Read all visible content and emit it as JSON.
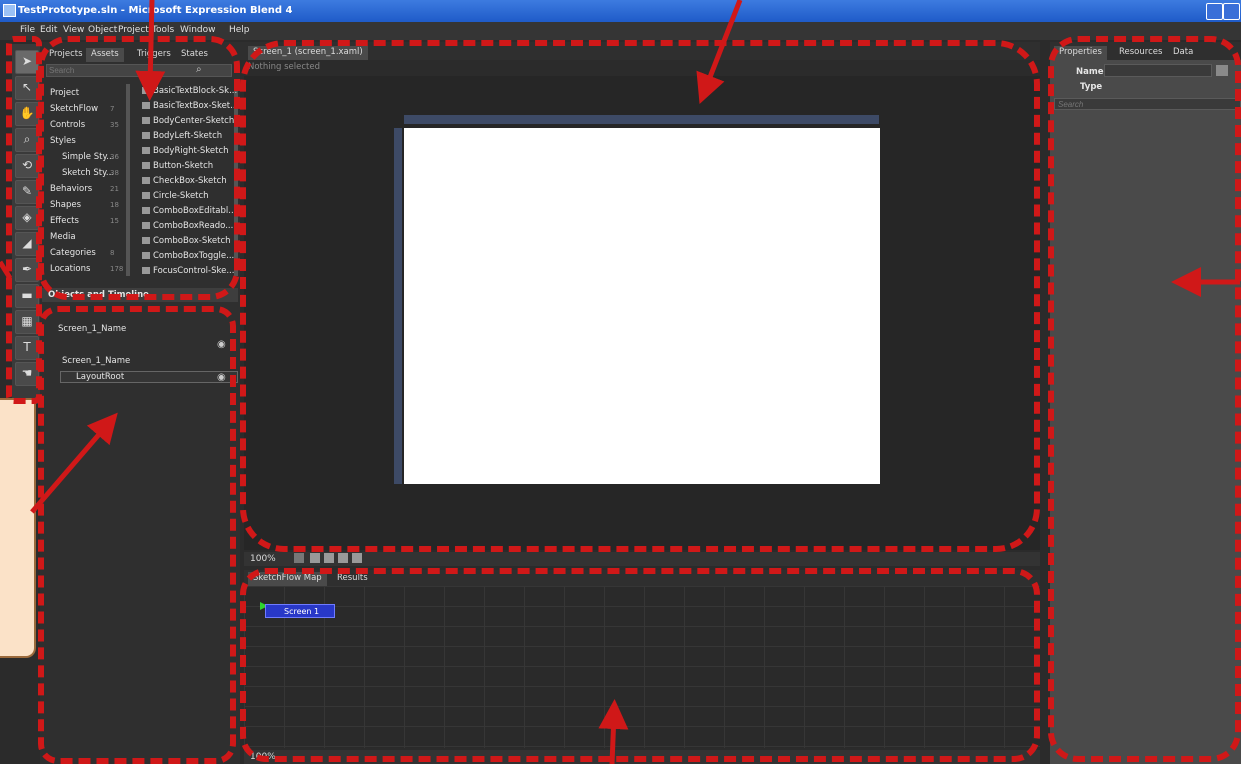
{
  "window": {
    "title": "TestPrototype.sln - Microsoft Expression Blend 4"
  },
  "menu": [
    "File",
    "Edit",
    "View",
    "Object",
    "Project",
    "Tools",
    "Window",
    "Help"
  ],
  "left_panel": {
    "tabs": [
      "Projects",
      "Assets",
      "Triggers",
      "States"
    ],
    "search_placeholder": "Search",
    "categories": [
      {
        "label": "Project",
        "count": ""
      },
      {
        "label": "SketchFlow",
        "count": "7"
      },
      {
        "label": "Controls",
        "count": "35"
      },
      {
        "label": "Styles",
        "count": ""
      },
      {
        "label": "Simple Sty...",
        "count": "36"
      },
      {
        "label": "Sketch Sty...",
        "count": "38"
      },
      {
        "label": "Behaviors",
        "count": "21"
      },
      {
        "label": "Shapes",
        "count": "18"
      },
      {
        "label": "Effects",
        "count": "15"
      },
      {
        "label": "Media",
        "count": ""
      },
      {
        "label": "Categories",
        "count": "8"
      },
      {
        "label": "Locations",
        "count": "178"
      }
    ],
    "assets": [
      "BasicTextBlock-Sk...",
      "BasicTextBox-Sket...",
      "BodyCenter-Sketch",
      "BodyLeft-Sketch",
      "BodyRight-Sketch",
      "Button-Sketch",
      "CheckBox-Sketch",
      "Circle-Sketch",
      "ComboBoxEditabl...",
      "ComboBoxReado...",
      "ComboBox-Sketch",
      "ComboBoxToggle...",
      "FocusControl-Ske..."
    ],
    "objects_header": "Objects and Timeline",
    "objects": {
      "root": "Screen_1_Name",
      "child": "Screen_1_Name",
      "layout_root": "LayoutRoot"
    }
  },
  "document": {
    "tab": "Screen_1 (screen_1.xaml)",
    "status": "Nothing selected",
    "zoom": "100%"
  },
  "bottom": {
    "tabs": [
      "SketchFlow Map",
      "Results"
    ],
    "node_label": "Screen 1",
    "zoom": "100%"
  },
  "right_panel": {
    "tabs": [
      "Properties",
      "Resources",
      "Data"
    ],
    "name_label": "Name",
    "type_label": "Type",
    "search_placeholder": "Search"
  },
  "colors": {
    "annotation": "#d01818",
    "titlebar": "#1f5bc8",
    "node": "#2838c8"
  }
}
